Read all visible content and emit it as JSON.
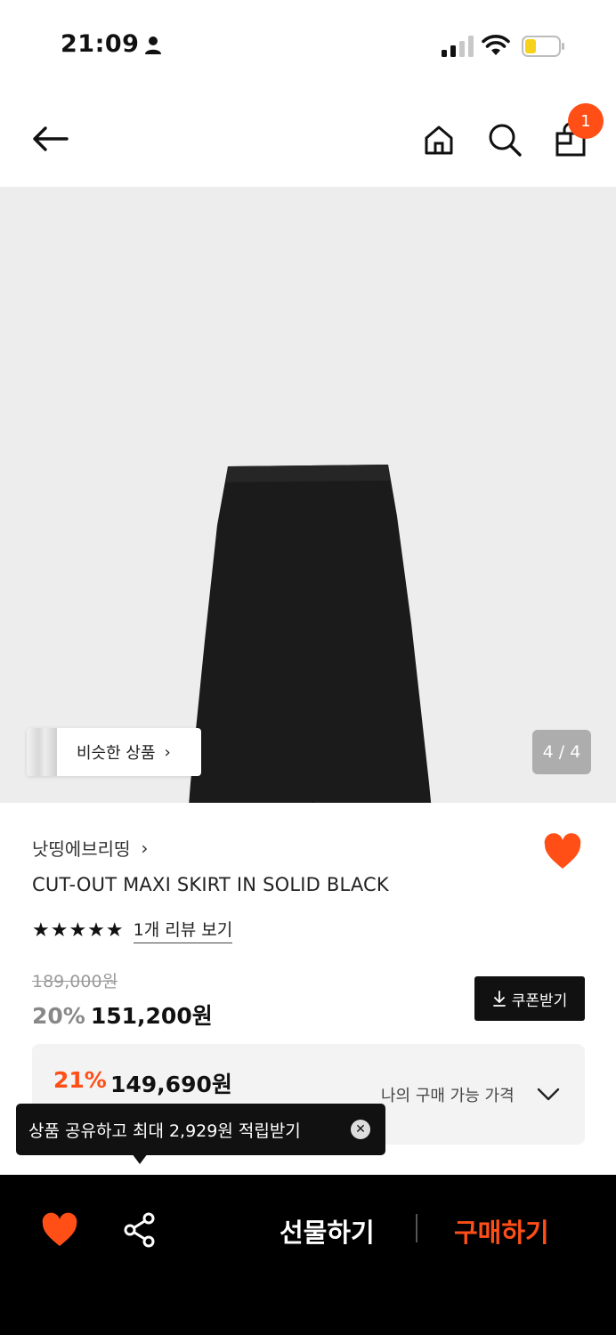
{
  "status_bar": {
    "time": "21:09",
    "icons": [
      "person-icon",
      "signal-icon",
      "wifi-icon",
      "battery-icon"
    ]
  },
  "header": {
    "icons": [
      "back-arrow-icon",
      "home-icon",
      "search-icon",
      "shopping-bag-icon"
    ],
    "cart_count": "1"
  },
  "gallery": {
    "similar_label": "비슷한 상품",
    "similar_chevron": "›",
    "counter": "4 / 4"
  },
  "product": {
    "brand": "낫띵에브리띵",
    "brand_chevron": "›",
    "title": "CUT-OUT MAXI SKIRT IN SOLID BLACK",
    "stars": "★★★★★",
    "rating": 5,
    "review_link": "1개 리뷰 보기",
    "original_price": "189,000원",
    "sale_percent": "20%",
    "sale_price": "151,200원",
    "coupon_label": "쿠폰받기"
  },
  "my_price": {
    "percent": "21%",
    "price": "149,690원",
    "label": "나의 구매 가능 가격"
  },
  "tooltip": {
    "text": "상품 공유하고 최대 2,929원 적립받기",
    "close": "✕"
  },
  "bottom_bar": {
    "gift_label": "선물하기",
    "buy_label": "구매하기"
  },
  "colors": {
    "accent": "#ff4f17",
    "dark": "#111111",
    "image_bg": "#ededed"
  }
}
